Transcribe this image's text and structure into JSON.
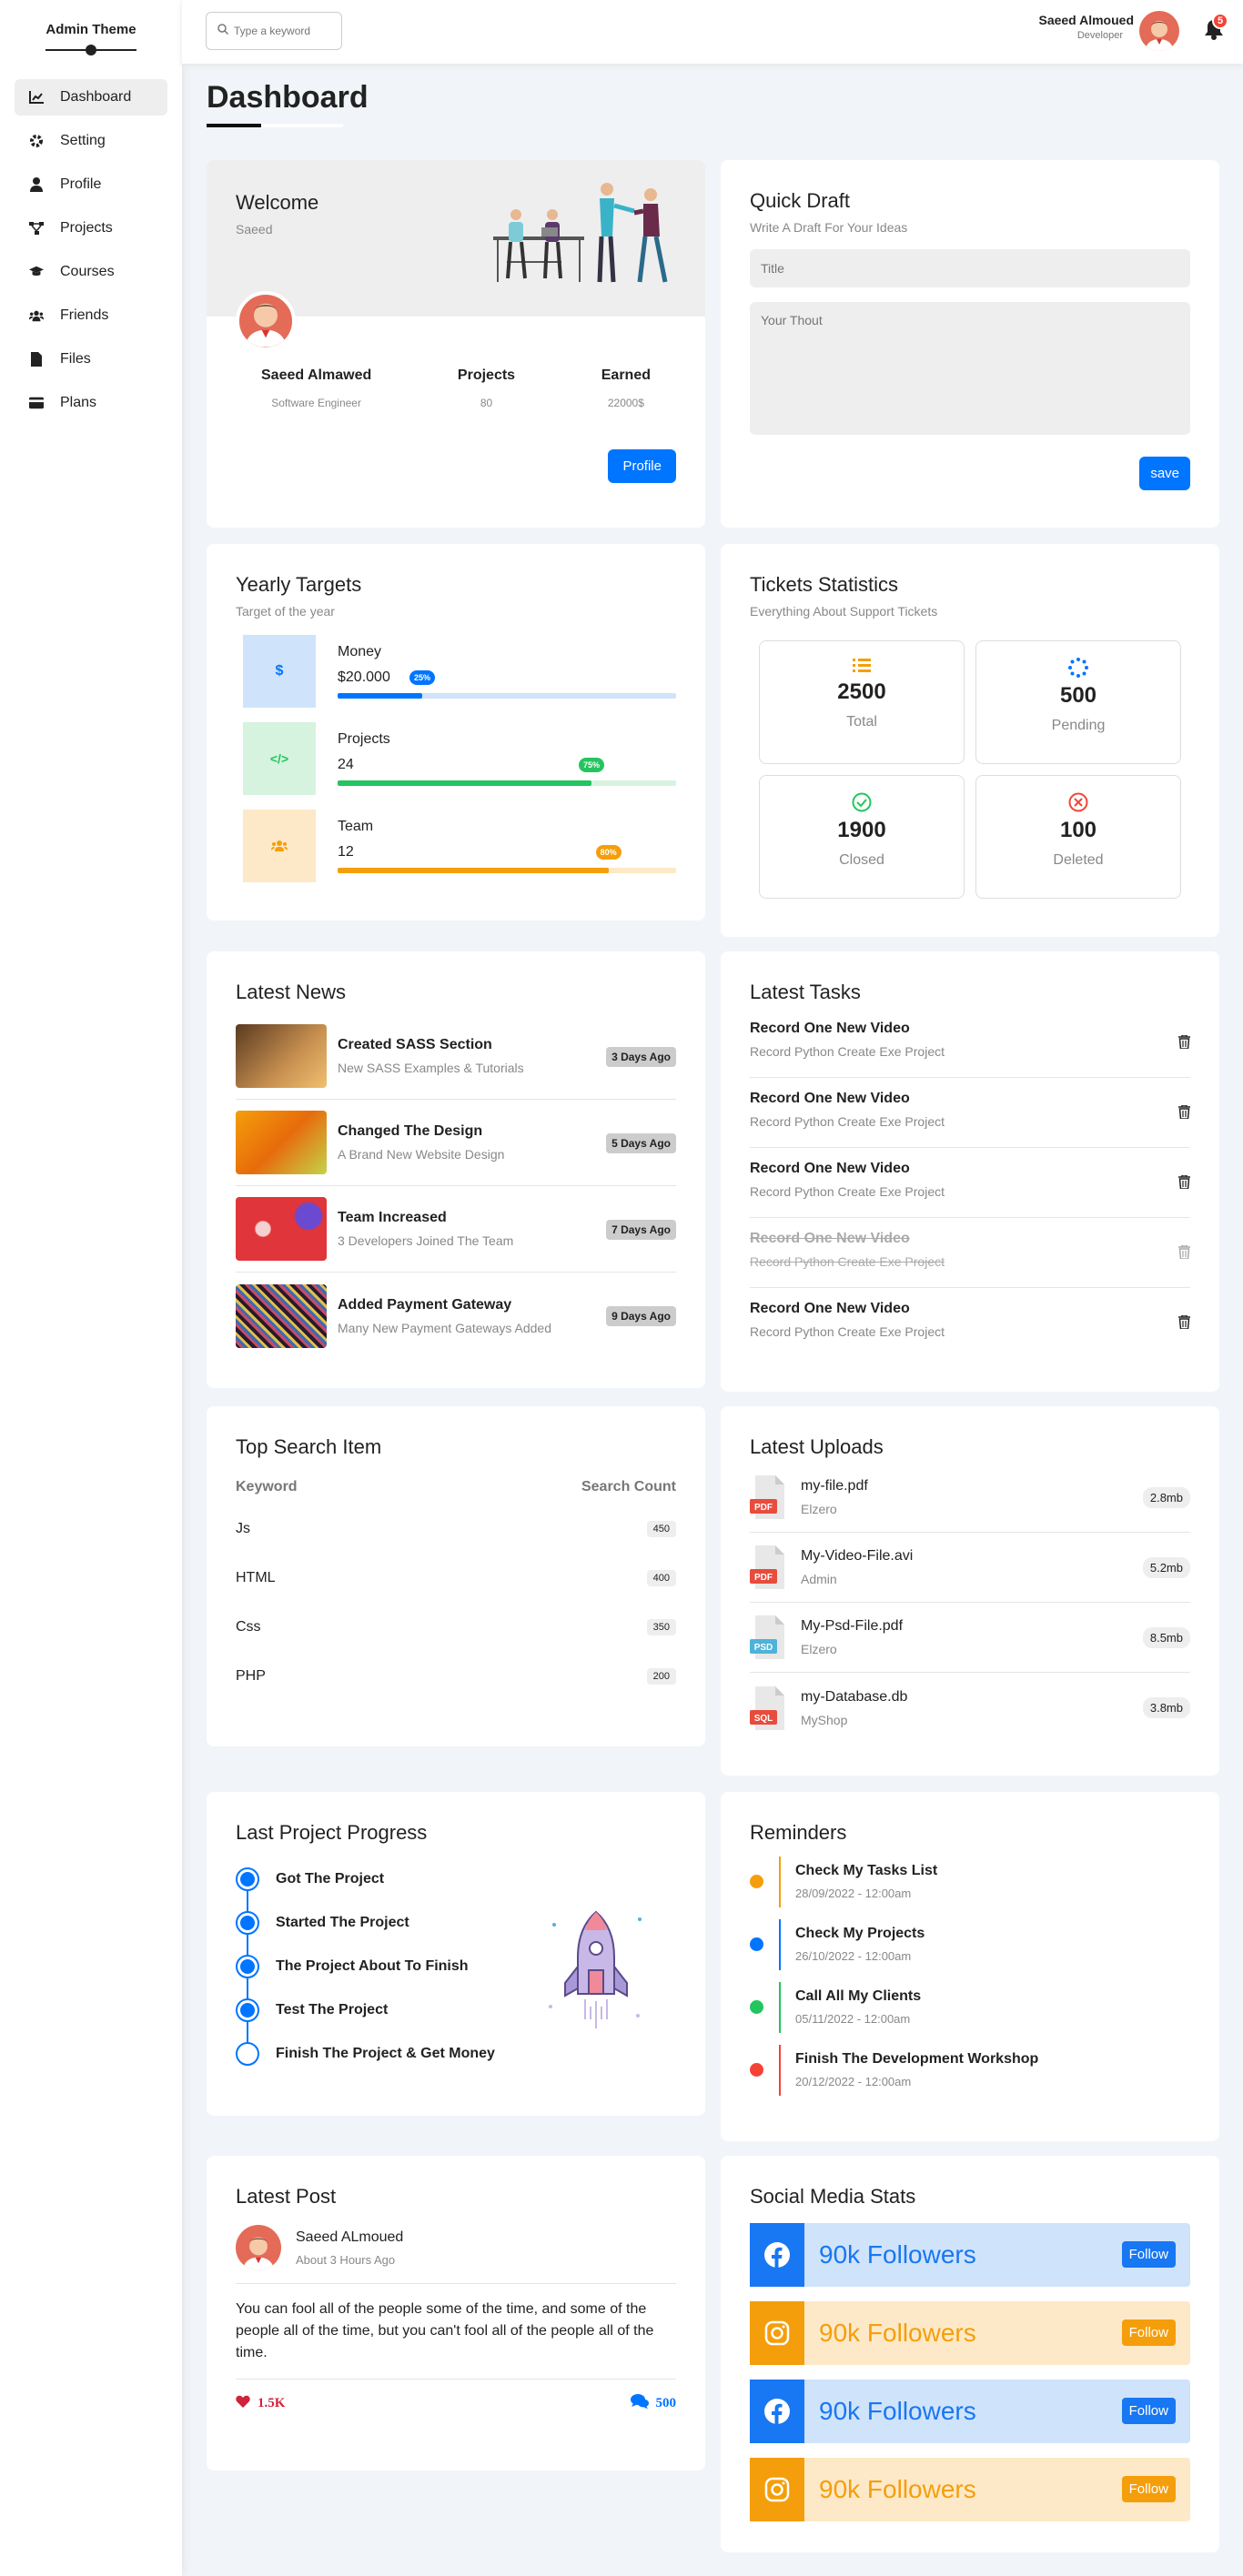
{
  "brand": "Admin Theme",
  "nav": [
    {
      "label": "Dashboard",
      "icon": "chart-icon"
    },
    {
      "label": "Setting",
      "icon": "gear-icon"
    },
    {
      "label": "Profile",
      "icon": "user-icon"
    },
    {
      "label": "Projects",
      "icon": "diagram-icon"
    },
    {
      "label": "Courses",
      "icon": "graduation-cap-icon"
    },
    {
      "label": "Friends",
      "icon": "users-icon"
    },
    {
      "label": "Files",
      "icon": "file-icon"
    },
    {
      "label": "Plans",
      "icon": "credit-card-icon"
    }
  ],
  "header": {
    "search_placeholder": "Type a keyword",
    "user_name": "Saeed Almoued",
    "user_role": "Developer",
    "notifications": "5"
  },
  "page_title": "Dashboard",
  "welcome": {
    "title": "Welcome",
    "name": "Saeed",
    "stats": [
      {
        "label": "Saeed Almawed",
        "value": "Software Engineer"
      },
      {
        "label": "Projects",
        "value": "80"
      },
      {
        "label": "Earned",
        "value": "22000$"
      }
    ],
    "button": "Profile"
  },
  "draft": {
    "title": "Quick Draft",
    "subtitle": "Write A Draft For Your Ideas",
    "title_placeholder": "Title",
    "body_placeholder": "Your Thout",
    "button": "save"
  },
  "targets": {
    "title": "Yearly Targets",
    "subtitle": "Target of the year",
    "items": [
      {
        "label": "Money",
        "value": "$20.000",
        "percent": "25%",
        "progress": 25,
        "color": "#0075ff",
        "bg": "#cfe3fb",
        "icon": "dollar-icon",
        "glyph": "$"
      },
      {
        "label": "Projects",
        "value": "24",
        "percent": "75%",
        "progress": 75,
        "color": "#22c55e",
        "bg": "#d6f3e0",
        "icon": "code-icon",
        "glyph": "</>"
      },
      {
        "label": "Team",
        "value": "12",
        "percent": "80%",
        "progress": 80,
        "color": "#f59e0b",
        "bg": "#fde9c7",
        "icon": "team-icon",
        "glyph": "👥"
      }
    ]
  },
  "tickets": {
    "title": "Tickets Statistics",
    "subtitle": "Everything About Support Tickets",
    "items": [
      {
        "value": "2500",
        "label": "Total",
        "color": "#f59e0b",
        "icon": "list-icon"
      },
      {
        "value": "500",
        "label": "Pending",
        "color": "#0075ff",
        "icon": "spinner-icon"
      },
      {
        "value": "1900",
        "label": "Closed",
        "color": "#22c55e",
        "icon": "check-circle-icon"
      },
      {
        "value": "100",
        "label": "Deleted",
        "color": "#f44336",
        "icon": "x-circle-icon"
      }
    ]
  },
  "news": {
    "title": "Latest News",
    "items": [
      {
        "title": "Created SASS Section",
        "sub": "New SASS Examples & Tutorials",
        "days": "3 Days Ago"
      },
      {
        "title": "Changed The Design",
        "sub": "A Brand New Website Design",
        "days": "5 Days Ago"
      },
      {
        "title": "Team Increased",
        "sub": "3 Developers Joined The Team",
        "days": "7 Days Ago"
      },
      {
        "title": "Added Payment Gateway",
        "sub": "Many New Payment Gateways Added",
        "days": "9 Days Ago"
      }
    ]
  },
  "tasks": {
    "title": "Latest Tasks",
    "items": [
      {
        "title": "Record One New Video",
        "sub": "Record Python Create Exe Project",
        "done": false
      },
      {
        "title": "Record One New Video",
        "sub": "Record Python Create Exe Project",
        "done": false
      },
      {
        "title": "Record One New Video",
        "sub": "Record Python Create Exe Project",
        "done": false
      },
      {
        "title": "Record One New Video",
        "sub": "Record Python Create Exe Project",
        "done": true
      },
      {
        "title": "Record One New Video",
        "sub": "Record Python Create Exe Project",
        "done": false
      }
    ]
  },
  "top_search": {
    "title": "Top Search Item",
    "col_keyword": "Keyword",
    "col_count": "Search Count",
    "rows": [
      {
        "keyword": "Js",
        "count": "450"
      },
      {
        "keyword": "HTML",
        "count": "400"
      },
      {
        "keyword": "Css",
        "count": "350"
      },
      {
        "keyword": "PHP",
        "count": "200"
      }
    ]
  },
  "uploads": {
    "title": "Latest Uploads",
    "items": [
      {
        "name": "my-file.pdf",
        "who": "Elzero",
        "size": "2.8mb",
        "ext": "PDF",
        "color": "#e74c3c"
      },
      {
        "name": "My-Video-File.avi",
        "who": "Admin",
        "size": "5.2mb",
        "ext": "PDF",
        "color": "#e74c3c"
      },
      {
        "name": "My-Psd-File.pdf",
        "who": "Elzero",
        "size": "8.5mb",
        "ext": "PSD",
        "color": "#4fb3d9"
      },
      {
        "name": "my-Database.db",
        "who": "MyShop",
        "size": "3.8mb",
        "ext": "SQL",
        "color": "#e74c3c"
      }
    ]
  },
  "project_progress": {
    "title": "Last Project Progress",
    "items": [
      {
        "label": "Got The Project",
        "done": true
      },
      {
        "label": "Started The Project",
        "done": true
      },
      {
        "label": "The Project About To Finish",
        "done": true
      },
      {
        "label": "Test The Project",
        "done": true
      },
      {
        "label": "Finish The Project & Get Money",
        "done": false
      }
    ]
  },
  "reminders": {
    "title": "Reminders",
    "items": [
      {
        "title": "Check My Tasks List",
        "date": "28/09/2022 - 12:00am",
        "color": "#f59e0b"
      },
      {
        "title": "Check My Projects",
        "date": "26/10/2022 - 12:00am",
        "color": "#0075ff"
      },
      {
        "title": "Call All My Clients",
        "date": "05/11/2022 - 12:00am",
        "color": "#22c55e"
      },
      {
        "title": "Finish The Development Workshop",
        "date": "20/12/2022 - 12:00am",
        "color": "#f44336"
      }
    ]
  },
  "post": {
    "title": "Latest Post",
    "author": "Saeed ALmoued",
    "time": "About 3 Hours Ago",
    "text": "You can fool all of the people some of the time, and some of the people all of the time, but you can't fool all of the people all of the time.",
    "likes": "1.5K",
    "comments": "500"
  },
  "social": {
    "title": "Social Media Stats",
    "items": [
      {
        "network": "facebook-icon",
        "text": "90k Followers",
        "button": "Follow",
        "color": "#1877f2",
        "bg": "#cfe3fb"
      },
      {
        "network": "instagram-icon",
        "text": "90k Followers",
        "button": "Follow",
        "color": "#f59e0b",
        "bg": "#fde9c7"
      },
      {
        "network": "facebook-icon",
        "text": "90k Followers",
        "button": "Follow",
        "color": "#1877f2",
        "bg": "#cfe3fb"
      },
      {
        "network": "instagram-icon",
        "text": "90k Followers",
        "button": "Follow",
        "color": "#f59e0b",
        "bg": "#fde9c7"
      }
    ]
  }
}
